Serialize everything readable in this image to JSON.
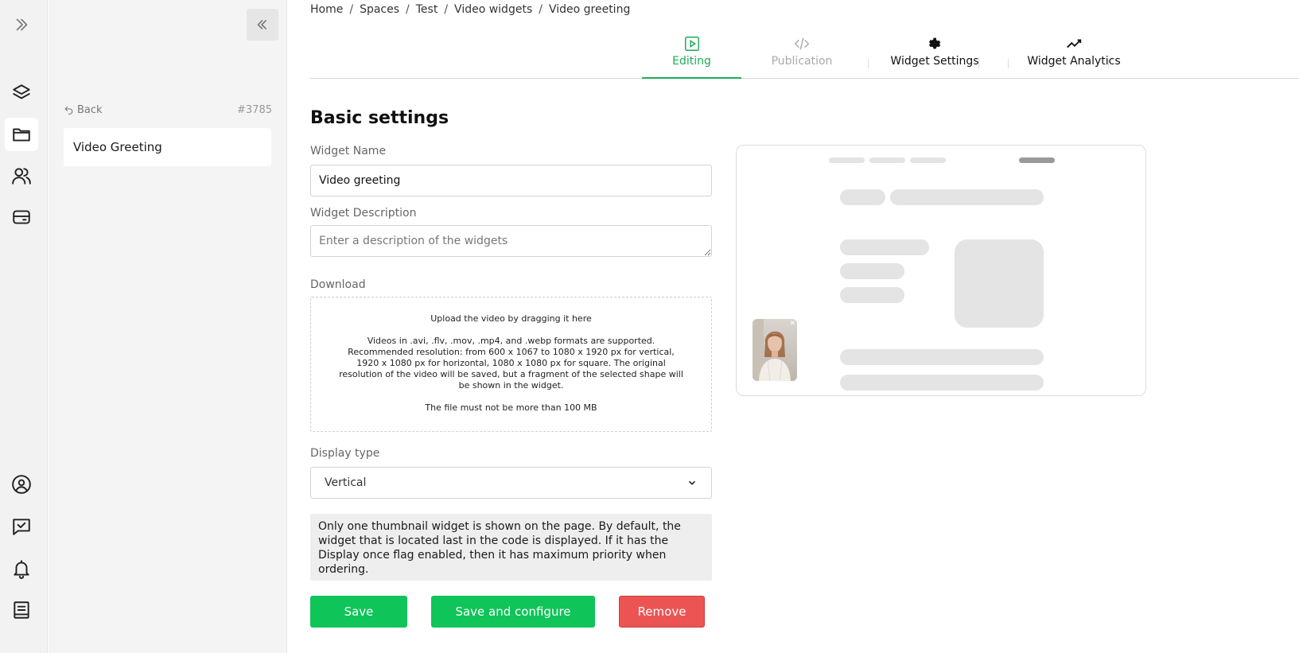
{
  "rail": {
    "icons": [
      "expand-icon",
      "layers-icon",
      "folder-icon",
      "users-icon",
      "wallet-icon",
      "profile-icon",
      "chat-check-icon",
      "bell-icon",
      "book-icon"
    ]
  },
  "sidebar": {
    "back_label": "Back",
    "id_label": "#3785",
    "item_label": "Video Greeting"
  },
  "breadcrumb": [
    "Home",
    "Spaces",
    "Test",
    "Video widgets",
    "Video greeting"
  ],
  "tabs": [
    {
      "label": "Editing",
      "icon": "play-icon",
      "state": "active"
    },
    {
      "label": "Publication",
      "icon": "code-icon",
      "state": "disabled"
    },
    {
      "label": "Widget Settings",
      "icon": "gear-icon",
      "state": "normal"
    },
    {
      "label": "Widget Analytics",
      "icon": "trend-icon",
      "state": "normal"
    }
  ],
  "form": {
    "title": "Basic settings",
    "name_label": "Widget Name",
    "name_value": "Video greeting",
    "description_label": "Widget Description",
    "description_placeholder": "Enter a description of the widgets",
    "download_label": "Download",
    "upload_title": "Upload the video by dragging it here",
    "upload_formats": "Videos in .avi, .flv, .mov, .mp4, and .webp formats are supported. Recommended resolution: from 600 x 1067 to 1080 x 1920 px for vertical, 1920 x 1080 px for horizontal, 1080 x 1080 px for square. The original resolution of the video will be saved, but a fragment of the selected shape will be shown in the widget.",
    "upload_limit": "The file must not be more than 100 MB",
    "display_type_label": "Display type",
    "display_type_value": "Vertical",
    "notice": "Only one thumbnail widget is shown on the page. By default, the widget that is located last in the code is displayed. If it has the Display once flag enabled, then it has maximum priority when ordering."
  },
  "buttons": {
    "save": "Save",
    "save_configure": "Save and configure",
    "remove": "Remove"
  },
  "colors": {
    "accent": "#0fc459",
    "danger": "#ec5454",
    "tab_active": "#1faa59"
  }
}
